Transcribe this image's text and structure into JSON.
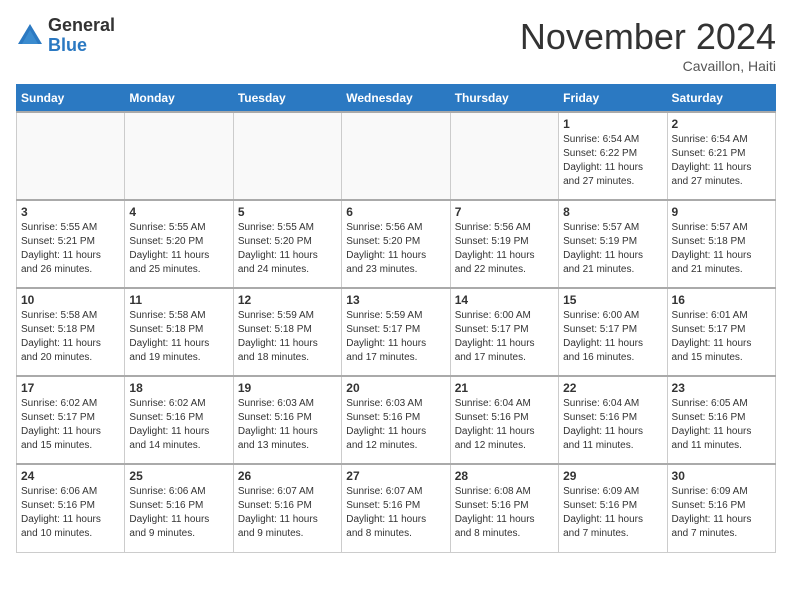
{
  "header": {
    "logo_general": "General",
    "logo_blue": "Blue",
    "month_title": "November 2024",
    "subtitle": "Cavaillon, Haiti"
  },
  "weekdays": [
    "Sunday",
    "Monday",
    "Tuesday",
    "Wednesday",
    "Thursday",
    "Friday",
    "Saturday"
  ],
  "weeks": [
    [
      {
        "day": "",
        "info": ""
      },
      {
        "day": "",
        "info": ""
      },
      {
        "day": "",
        "info": ""
      },
      {
        "day": "",
        "info": ""
      },
      {
        "day": "",
        "info": ""
      },
      {
        "day": "1",
        "info": "Sunrise: 6:54 AM\nSunset: 6:22 PM\nDaylight: 11 hours\nand 27 minutes."
      },
      {
        "day": "2",
        "info": "Sunrise: 6:54 AM\nSunset: 6:21 PM\nDaylight: 11 hours\nand 27 minutes."
      }
    ],
    [
      {
        "day": "3",
        "info": "Sunrise: 5:55 AM\nSunset: 5:21 PM\nDaylight: 11 hours\nand 26 minutes."
      },
      {
        "day": "4",
        "info": "Sunrise: 5:55 AM\nSunset: 5:20 PM\nDaylight: 11 hours\nand 25 minutes."
      },
      {
        "day": "5",
        "info": "Sunrise: 5:55 AM\nSunset: 5:20 PM\nDaylight: 11 hours\nand 24 minutes."
      },
      {
        "day": "6",
        "info": "Sunrise: 5:56 AM\nSunset: 5:20 PM\nDaylight: 11 hours\nand 23 minutes."
      },
      {
        "day": "7",
        "info": "Sunrise: 5:56 AM\nSunset: 5:19 PM\nDaylight: 11 hours\nand 22 minutes."
      },
      {
        "day": "8",
        "info": "Sunrise: 5:57 AM\nSunset: 5:19 PM\nDaylight: 11 hours\nand 21 minutes."
      },
      {
        "day": "9",
        "info": "Sunrise: 5:57 AM\nSunset: 5:18 PM\nDaylight: 11 hours\nand 21 minutes."
      }
    ],
    [
      {
        "day": "10",
        "info": "Sunrise: 5:58 AM\nSunset: 5:18 PM\nDaylight: 11 hours\nand 20 minutes."
      },
      {
        "day": "11",
        "info": "Sunrise: 5:58 AM\nSunset: 5:18 PM\nDaylight: 11 hours\nand 19 minutes."
      },
      {
        "day": "12",
        "info": "Sunrise: 5:59 AM\nSunset: 5:18 PM\nDaylight: 11 hours\nand 18 minutes."
      },
      {
        "day": "13",
        "info": "Sunrise: 5:59 AM\nSunset: 5:17 PM\nDaylight: 11 hours\nand 17 minutes."
      },
      {
        "day": "14",
        "info": "Sunrise: 6:00 AM\nSunset: 5:17 PM\nDaylight: 11 hours\nand 17 minutes."
      },
      {
        "day": "15",
        "info": "Sunrise: 6:00 AM\nSunset: 5:17 PM\nDaylight: 11 hours\nand 16 minutes."
      },
      {
        "day": "16",
        "info": "Sunrise: 6:01 AM\nSunset: 5:17 PM\nDaylight: 11 hours\nand 15 minutes."
      }
    ],
    [
      {
        "day": "17",
        "info": "Sunrise: 6:02 AM\nSunset: 5:17 PM\nDaylight: 11 hours\nand 15 minutes."
      },
      {
        "day": "18",
        "info": "Sunrise: 6:02 AM\nSunset: 5:16 PM\nDaylight: 11 hours\nand 14 minutes."
      },
      {
        "day": "19",
        "info": "Sunrise: 6:03 AM\nSunset: 5:16 PM\nDaylight: 11 hours\nand 13 minutes."
      },
      {
        "day": "20",
        "info": "Sunrise: 6:03 AM\nSunset: 5:16 PM\nDaylight: 11 hours\nand 12 minutes."
      },
      {
        "day": "21",
        "info": "Sunrise: 6:04 AM\nSunset: 5:16 PM\nDaylight: 11 hours\nand 12 minutes."
      },
      {
        "day": "22",
        "info": "Sunrise: 6:04 AM\nSunset: 5:16 PM\nDaylight: 11 hours\nand 11 minutes."
      },
      {
        "day": "23",
        "info": "Sunrise: 6:05 AM\nSunset: 5:16 PM\nDaylight: 11 hours\nand 11 minutes."
      }
    ],
    [
      {
        "day": "24",
        "info": "Sunrise: 6:06 AM\nSunset: 5:16 PM\nDaylight: 11 hours\nand 10 minutes."
      },
      {
        "day": "25",
        "info": "Sunrise: 6:06 AM\nSunset: 5:16 PM\nDaylight: 11 hours\nand 9 minutes."
      },
      {
        "day": "26",
        "info": "Sunrise: 6:07 AM\nSunset: 5:16 PM\nDaylight: 11 hours\nand 9 minutes."
      },
      {
        "day": "27",
        "info": "Sunrise: 6:07 AM\nSunset: 5:16 PM\nDaylight: 11 hours\nand 8 minutes."
      },
      {
        "day": "28",
        "info": "Sunrise: 6:08 AM\nSunset: 5:16 PM\nDaylight: 11 hours\nand 8 minutes."
      },
      {
        "day": "29",
        "info": "Sunrise: 6:09 AM\nSunset: 5:16 PM\nDaylight: 11 hours\nand 7 minutes."
      },
      {
        "day": "30",
        "info": "Sunrise: 6:09 AM\nSunset: 5:16 PM\nDaylight: 11 hours\nand 7 minutes."
      }
    ]
  ]
}
